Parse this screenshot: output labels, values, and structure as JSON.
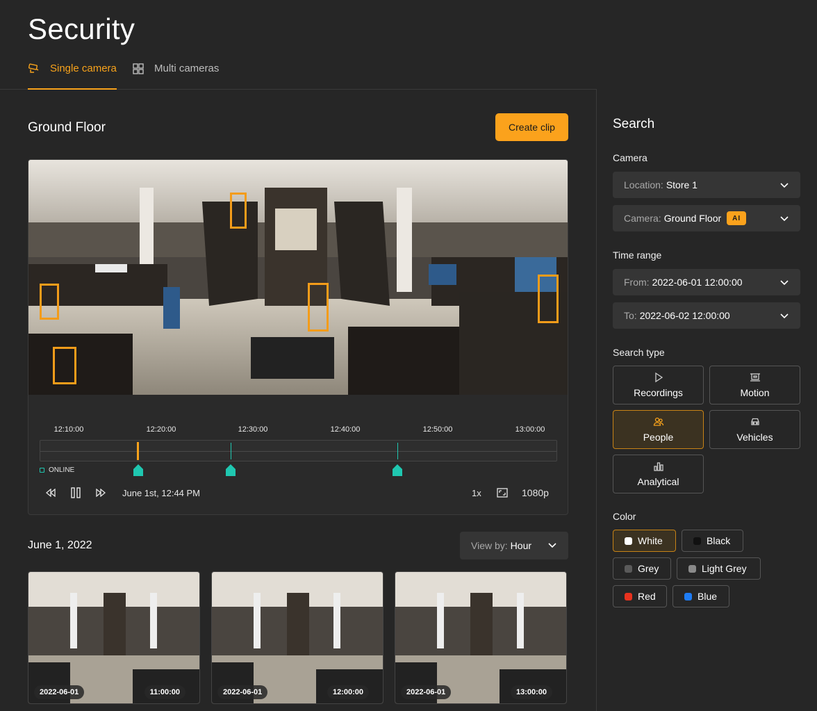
{
  "page": {
    "title": "Security"
  },
  "tabs": [
    {
      "label": "Single camera",
      "icon": "cctv-camera-icon",
      "active": true
    },
    {
      "label": "Multi cameras",
      "icon": "grid-icon",
      "active": false
    }
  ],
  "main": {
    "camera_name": "Ground Floor",
    "create_clip_label": "Create clip",
    "timeline": {
      "labels": [
        "12:10:00",
        "12:20:00",
        "12:30:00",
        "12:40:00",
        "12:50:00",
        "13:00:00"
      ],
      "status": "ONLINE",
      "current_time": "June 1st, 12:44 PM",
      "speed": "1x",
      "quality": "1080p",
      "accent": "#1fc7b0"
    },
    "date_heading": "June 1, 2022",
    "view_by": {
      "label": "View by:",
      "value": "Hour"
    },
    "thumbnails": [
      {
        "date": "2022-06-01",
        "time": "11:00:00"
      },
      {
        "date": "2022-06-01",
        "time": "12:00:00"
      },
      {
        "date": "2022-06-01",
        "time": "13:00:00"
      }
    ]
  },
  "search": {
    "title": "Search",
    "camera_section": "Camera",
    "location": {
      "label": "Location:",
      "value": "Store 1"
    },
    "camera": {
      "label": "Camera:",
      "value": "Ground Floor",
      "badge": "AI"
    },
    "time_range_section": "Time range",
    "from": {
      "label": "From:",
      "value": "2022-06-01 12:00:00"
    },
    "to": {
      "label": "To:",
      "value": "2022-06-02 12:00:00"
    },
    "search_type_section": "Search type",
    "search_types": [
      {
        "label": "Recordings",
        "icon": "play-icon",
        "active": false
      },
      {
        "label": "Motion",
        "icon": "motion-icon",
        "active": false
      },
      {
        "label": "People",
        "icon": "people-icon",
        "active": true
      },
      {
        "label": "Vehicles",
        "icon": "car-icon",
        "active": false
      },
      {
        "label": "Analytical",
        "icon": "bar-chart-icon",
        "active": false
      }
    ],
    "color_section": "Color",
    "colors": [
      {
        "label": "White",
        "swatch": "#ffffff",
        "active": true
      },
      {
        "label": "Black",
        "swatch": "#111111",
        "active": false
      },
      {
        "label": "Grey",
        "swatch": "#5a5a5a",
        "active": false
      },
      {
        "label": "Light Grey",
        "swatch": "#8a8a8a",
        "active": false
      },
      {
        "label": "Red",
        "swatch": "#e8321e",
        "active": false
      },
      {
        "label": "Blue",
        "swatch": "#1e7cf5",
        "active": false
      }
    ]
  },
  "theme": {
    "accent": "#fba21c",
    "background": "#262626",
    "teal": "#1fc7b0"
  }
}
